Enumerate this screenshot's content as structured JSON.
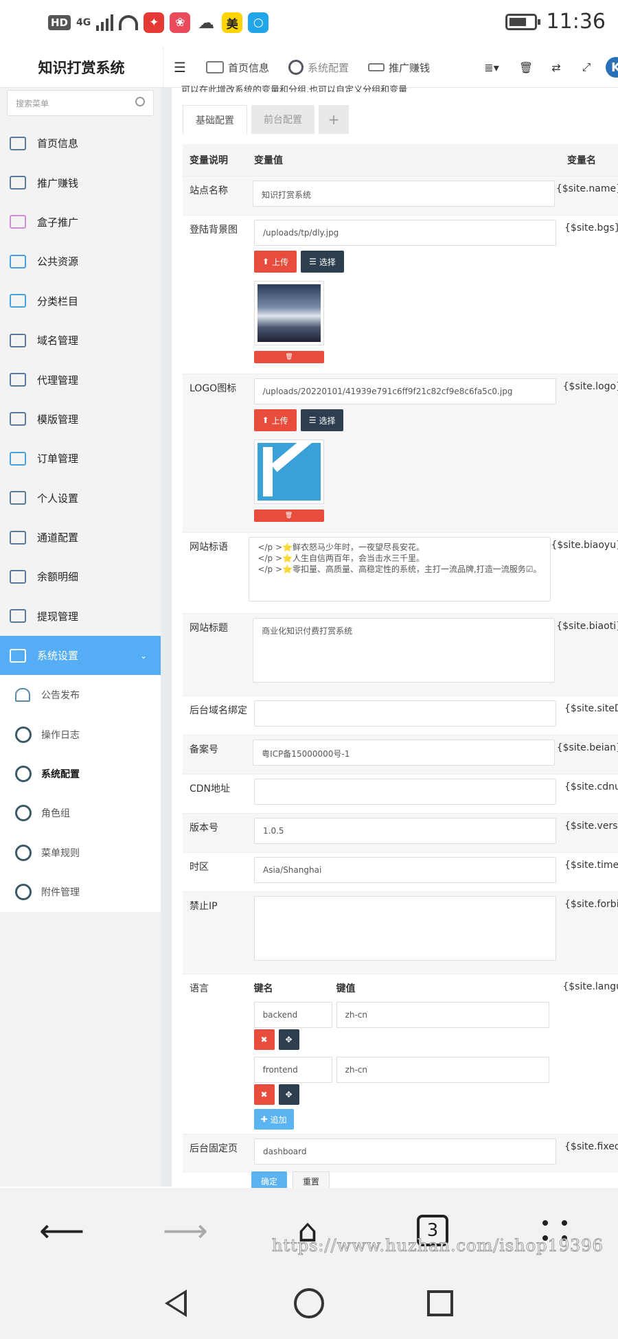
{
  "status_bar": {
    "hd": "HD",
    "network": "4G",
    "time": "11:36",
    "apps": [
      {
        "icon": "red-packet-icon",
        "color": "#e53935",
        "label": ""
      },
      {
        "icon": "huawei-icon",
        "color": "#ea4a5a",
        "label": ""
      },
      {
        "icon": "wechat-icon",
        "color": "#ffffff",
        "label": ""
      },
      {
        "icon": "meituan-icon",
        "color": "#ffd400",
        "label": "美"
      },
      {
        "icon": "search-app-icon",
        "color": "#21a4e8",
        "label": ""
      }
    ]
  },
  "header": {
    "app_title": "知识打赏系统",
    "nav": [
      {
        "label": "首页信息",
        "icon": "home-info-icon"
      },
      {
        "label": "系统配置",
        "icon": "settings-ring-icon"
      },
      {
        "label": "推广赚钱",
        "icon": "promote-icon"
      }
    ],
    "right_icons": [
      "list-dropdown-icon",
      "trash-icon",
      "translate-icon",
      "fullscreen-icon",
      "avatar-k-icon"
    ],
    "avatar_letter": "K"
  },
  "sidebar": {
    "search_placeholder": "搜索菜单",
    "items": [
      {
        "label": "首页信息"
      },
      {
        "label": "推广赚钱"
      },
      {
        "label": "盒子推广"
      },
      {
        "label": "公共资源"
      },
      {
        "label": "分类栏目"
      },
      {
        "label": "域名管理"
      },
      {
        "label": "代理管理"
      },
      {
        "label": "模版管理"
      },
      {
        "label": "订单管理"
      },
      {
        "label": "个人设置"
      },
      {
        "label": "通道配置"
      },
      {
        "label": "余额明细"
      },
      {
        "label": "提现管理"
      }
    ],
    "active_group": {
      "label": "系统设置"
    },
    "sub_items": [
      {
        "label": "公告发布"
      },
      {
        "label": "操作日志"
      },
      {
        "label": "系统配置"
      },
      {
        "label": "角色组"
      },
      {
        "label": "菜单规则"
      },
      {
        "label": "附件管理"
      }
    ]
  },
  "main": {
    "help_text": "可以在此增改系统的变量和分组,也可以自定义分组和变量",
    "tabs": [
      {
        "label": "基础配置"
      },
      {
        "label": "前台配置"
      },
      {
        "label": "+"
      }
    ],
    "columns": {
      "desc": "变量说明",
      "value": "变量值",
      "name": "变量名"
    },
    "rows": {
      "site_name": {
        "label": "站点名称",
        "value": "知识打赏系统",
        "var": "{$site.name}"
      },
      "login_bg": {
        "label": "登陆背景图",
        "value": "/uploads/tp/dly.jpg",
        "var": "{$site.bgs}"
      },
      "logo": {
        "label": "LOGO图标",
        "value": "/uploads/20220101/41939e791c6ff9f21c82cf9e8c6fa5c0.jpg",
        "var": "{$site.logo}"
      },
      "slogan": {
        "label": "网站标语",
        "lines": [
          "</p >⭐鲜衣怒马少年时，一夜望尽長安花。",
          "</p >⭐人生自信两百年，会当击水三千里。",
          "</p >⭐零扣量、高质量、高稳定性的系统，主打一流品牌,打造一流服务☑。"
        ],
        "var": "{$site.biaoyu}"
      },
      "site_title": {
        "label": "网站标题",
        "value": "商业化知识付费打赏系统",
        "var": "{$site.biaoti}"
      },
      "admin_domain": {
        "label": "后台域名绑定",
        "value": "",
        "var": "{$site.siteD"
      },
      "beian": {
        "label": "备案号",
        "value": "粤ICP备15000000号-1",
        "var": "{$site.beian}"
      },
      "cdn": {
        "label": "CDN地址",
        "value": "",
        "var": "{$site.cdnu"
      },
      "version": {
        "label": "版本号",
        "value": "1.0.5",
        "var": "{$site.versi"
      },
      "timezone": {
        "label": "时区",
        "value": "Asia/Shanghai",
        "var": "{$site.time"
      },
      "forbid_ip": {
        "label": "禁止IP",
        "value": "",
        "var": "{$site.forbi"
      },
      "lang": {
        "label": "语言",
        "key_header": "键名",
        "value_header": "键值",
        "pairs": [
          {
            "key": "backend",
            "value": "zh-cn"
          },
          {
            "key": "frontend",
            "value": "zh-cn"
          }
        ],
        "add_label": "追加",
        "var": "{$site.langu"
      },
      "fixed_page": {
        "label": "后台固定页",
        "value": "dashboard",
        "var": "{$site.fixed"
      }
    },
    "upload_label": "上传",
    "choose_label": "选择",
    "submit_label": "确定",
    "reset_label": "重置"
  },
  "browser_bar": {
    "tab_count": "3",
    "watermark": "https://www.huzhan.com/ishop19396"
  }
}
